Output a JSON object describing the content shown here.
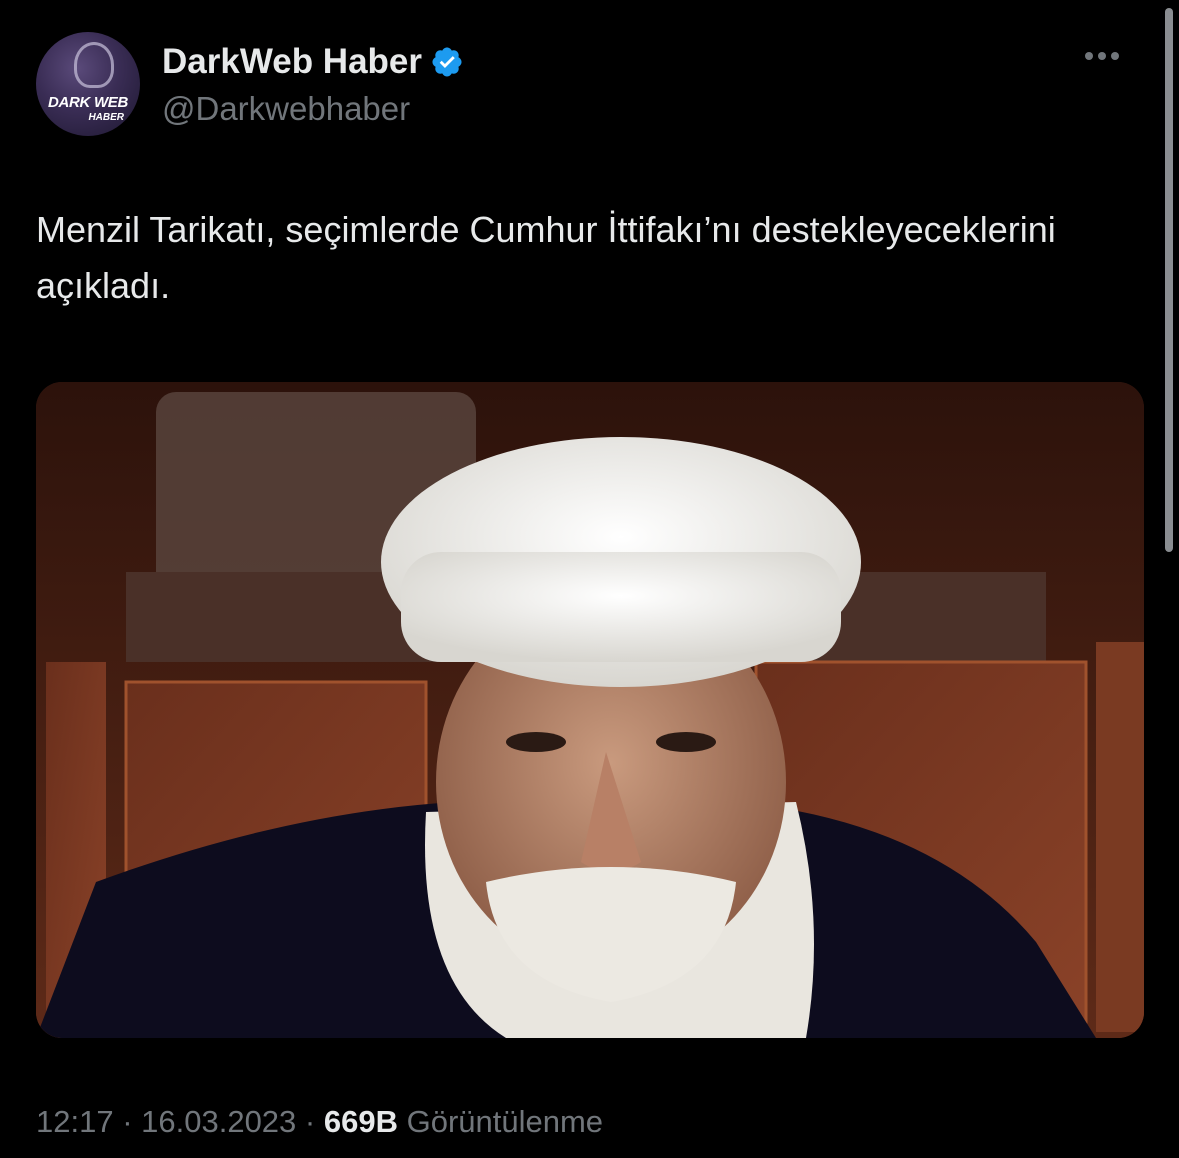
{
  "author": {
    "display_name": "DarkWeb Haber",
    "handle": "@Darkwebhaber",
    "verified": true,
    "avatar_text": "DARK WEB",
    "avatar_subtext": "HABER"
  },
  "tweet": {
    "text": "Menzil Tarikatı, seçimlerde Cumhur İttifakı’nı destekleyeceklerini açıkladı."
  },
  "meta": {
    "time": "12:17",
    "separator": " · ",
    "date": "16.03.2023",
    "views_count": "669B",
    "views_label": "Görüntülenme"
  },
  "colors": {
    "background": "#000000",
    "text_primary": "#e7e9ea",
    "text_secondary": "#71767b",
    "verified_blue": "#1d9bf0"
  },
  "icons": {
    "verified": "verified-badge-icon",
    "more": "more-horizontal-icon"
  }
}
